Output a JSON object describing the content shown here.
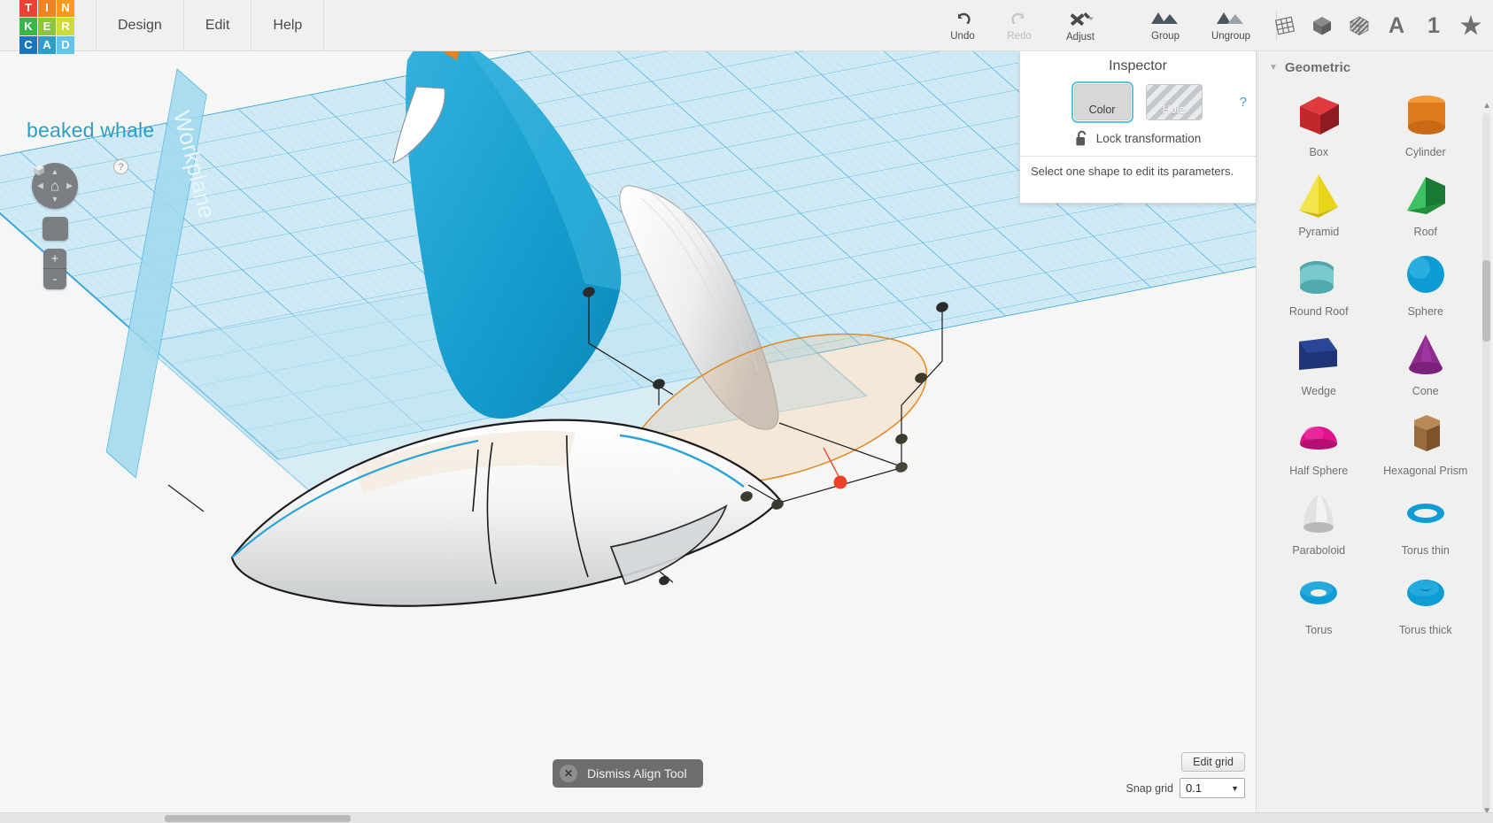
{
  "app": {
    "brand_letters": [
      {
        "ch": "T",
        "color": "#ee4136"
      },
      {
        "ch": "I",
        "color": "#f58220"
      },
      {
        "ch": "N",
        "color": "#f8991d"
      },
      {
        "ch": "K",
        "color": "#39b54a"
      },
      {
        "ch": "E",
        "color": "#8cc63e"
      },
      {
        "ch": "R",
        "color": "#cddc39"
      },
      {
        "ch": "C",
        "color": "#1b75bb"
      },
      {
        "ch": "A",
        "color": "#2f9ec4"
      },
      {
        "ch": "D",
        "color": "#62c4e8"
      }
    ],
    "menus": [
      "Design",
      "Edit",
      "Help"
    ],
    "project_title": "beaked whale",
    "accent_color": "#2f9ec4"
  },
  "toolbar": {
    "undo": "Undo",
    "redo": "Redo",
    "adjust": "Adjust",
    "group": "Group",
    "ungroup": "Ungroup",
    "right_icons": [
      {
        "name": "workplane-icon",
        "glyph": ""
      },
      {
        "name": "solid-cube-icon",
        "glyph": ""
      },
      {
        "name": "striped-cube-icon",
        "glyph": ""
      },
      {
        "name": "text-a-icon",
        "glyph": "A"
      },
      {
        "name": "number-one-icon",
        "glyph": "1"
      },
      {
        "name": "star-icon",
        "glyph": "★"
      }
    ]
  },
  "inspector": {
    "title": "Inspector",
    "color_label": "Color",
    "hole_label": "Hole",
    "lock_label": "Lock transformation",
    "note": "Select one shape to edit its parameters.",
    "help": "?"
  },
  "viewport": {
    "workplane_label": "Workplane",
    "nav_help": "?",
    "zoom_in": "+",
    "zoom_out": "-",
    "home_icon": "⌂"
  },
  "align_tool": {
    "dismiss_label": "Dismiss Align Tool",
    "close_glyph": "✕"
  },
  "grid_controls": {
    "edit_grid_label": "Edit grid",
    "snap_grid_label": "Snap grid",
    "snap_grid_value": "0.1",
    "caret": "▼"
  },
  "shapes_panel": {
    "section_title": "Geometric",
    "collapse_caret": "▼",
    "expand_chevron": "❯",
    "shapes": [
      {
        "label": "Box",
        "kind": "box",
        "color": "#c1272d",
        "color2": "#e03a3e"
      },
      {
        "label": "Cylinder",
        "kind": "cylinder",
        "color": "#e07a1f",
        "color2": "#f29a35"
      },
      {
        "label": "Pyramid",
        "kind": "pyramid",
        "color": "#e8d51a",
        "color2": "#f2e44d"
      },
      {
        "label": "Roof",
        "kind": "roof",
        "color": "#25a249",
        "color2": "#3fc163"
      },
      {
        "label": "Round Roof",
        "kind": "roundroof",
        "color": "#4fa9ad",
        "color2": "#77c9cc"
      },
      {
        "label": "Sphere",
        "kind": "sphere",
        "color": "#0f9bd4",
        "color2": "#41bde8"
      },
      {
        "label": "Wedge",
        "kind": "wedge",
        "color": "#1f3477",
        "color2": "#2b4696"
      },
      {
        "label": "Cone",
        "kind": "cone",
        "color": "#8e2a8e",
        "color2": "#ad3fad"
      },
      {
        "label": "Half Sphere",
        "kind": "halfsphere",
        "color": "#e0138e",
        "color2": "#f23ba8"
      },
      {
        "label": "Hexagonal Prism",
        "kind": "hexprism",
        "color": "#9a6b3c",
        "color2": "#b98a55"
      },
      {
        "label": "Paraboloid",
        "kind": "paraboloid",
        "color": "#b9b9b7",
        "color2": "#e2e2e0"
      },
      {
        "label": "Torus thin",
        "kind": "torusthin",
        "color": "#0f9bd4",
        "color2": "#41bde8"
      },
      {
        "label": "Torus",
        "kind": "torus",
        "color": "#0f9bd4",
        "color2": "#41bde8"
      },
      {
        "label": "Torus thick",
        "kind": "torusthick",
        "color": "#0f9bd4",
        "color2": "#41bde8"
      }
    ]
  }
}
